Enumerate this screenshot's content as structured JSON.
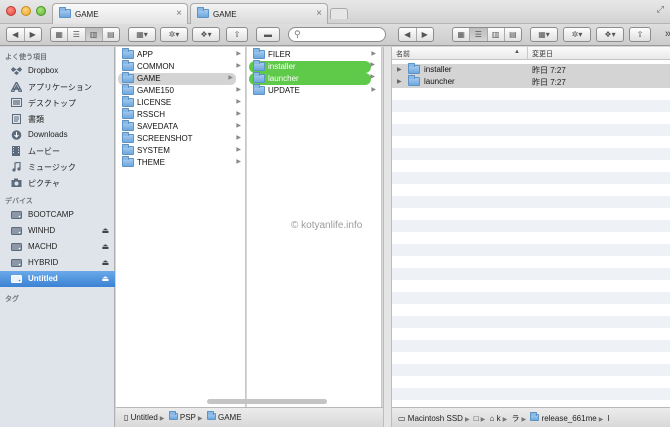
{
  "tabs": [
    {
      "label": "GAME"
    },
    {
      "label": "GAME"
    }
  ],
  "toolbar": {
    "back": "◀",
    "forward": "▶",
    "search_placeholder": ""
  },
  "sidebar": {
    "favorites_header": "よく使う項目",
    "favorites": [
      "Dropbox",
      "アプリケーション",
      "デスクトップ",
      "書類",
      "Downloads",
      "ムービー",
      "ミュージック",
      "ピクチャ"
    ],
    "devices_header": "デバイス",
    "devices": [
      "BOOTCAMP",
      "WINHD",
      "MACHD",
      "HYBRID",
      "Untitled"
    ],
    "tags_header": "タグ"
  },
  "column1": [
    "APP",
    "COMMON",
    "GAME",
    "GAME150",
    "LICENSE",
    "RSSCH",
    "SAVEDATA",
    "SCREENSHOT",
    "SYSTEM",
    "THEME"
  ],
  "column2": [
    "FILER",
    "installer",
    "launcher",
    "UPDATE"
  ],
  "listview": {
    "col_name": "名前",
    "col_date": "変更日",
    "rows": [
      {
        "name": "installer",
        "date": "昨日 7:27"
      },
      {
        "name": "launcher",
        "date": "昨日 7:27"
      }
    ]
  },
  "pathbar_left": [
    "Untitled",
    "PSP",
    "GAME"
  ],
  "pathbar_right": [
    "Macintosh SSD",
    "□",
    "k",
    "ラ",
    "release_661me",
    "l"
  ],
  "watermark": "© kotyanlife.info",
  "colors": {
    "selection_green": "#5fc94a",
    "sidebar_selected": "#3c82d4"
  }
}
